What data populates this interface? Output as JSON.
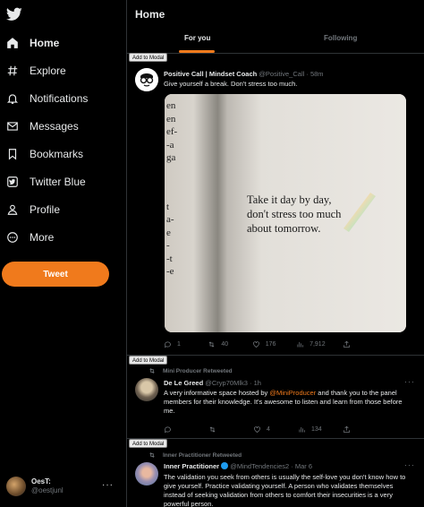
{
  "sidebar": {
    "nav": [
      {
        "label": "Home",
        "icon": "home-icon",
        "active": true
      },
      {
        "label": "Explore",
        "icon": "hashtag-icon"
      },
      {
        "label": "Notifications",
        "icon": "bell-icon"
      },
      {
        "label": "Messages",
        "icon": "envelope-icon"
      },
      {
        "label": "Bookmarks",
        "icon": "bookmark-icon"
      },
      {
        "label": "Twitter Blue",
        "icon": "twitter-blue-icon"
      },
      {
        "label": "Profile",
        "icon": "person-icon"
      },
      {
        "label": "More",
        "icon": "more-circle-icon"
      }
    ],
    "tweet_button": "Tweet",
    "account": {
      "name": "OesT:",
      "handle": "@oestjunl"
    }
  },
  "header": {
    "title": "Home",
    "tabs": [
      "For you",
      "Following"
    ]
  },
  "modal_tag": "Add to Modal",
  "tweets": [
    {
      "retweeted_by": "",
      "name": "Positive Call | Mindset Coach",
      "handle": "@Positive_Call",
      "time": "58m",
      "text": "Give yourself a break. Don't stress too much.",
      "image_text": [
        "Take it day by day,",
        "don't stress too much",
        "about tomorrow."
      ],
      "image_margin_text": [
        "en",
        "en",
        "ef-",
        "-a",
        "ga",
        "t",
        "a-",
        "e",
        "-",
        "-t",
        "-e"
      ],
      "stats": {
        "replies": "1",
        "retweets": "40",
        "likes": "176",
        "views": "7,912"
      }
    },
    {
      "retweeted_by": "Mini Producer Retweeted",
      "name": "De Le Greed",
      "handle": "@Cryp70Mlk3",
      "time": "1h",
      "text_parts": [
        "A very informative space hosted by ",
        "@MiniProducer",
        " and thank you to the panel members for their knowledge.  It's awesome to listen and learn from those before me."
      ],
      "stats": {
        "replies": "",
        "retweets": "",
        "likes": "4",
        "views": "134"
      }
    },
    {
      "retweeted_by": "Inner Practitioner Retweeted",
      "name": "Inner Practitioner",
      "handle": "@MindTendencies2",
      "time": "Mar 6",
      "text": "The validation you seek from others is usually the self-love you don't know how to give yourself. Practice validating yourself. A person who validates themselves instead of seeking validation from others to comfort their insecurities is a very powerful person."
    }
  ],
  "colors": {
    "accent": "#f07a1c",
    "background": "#000000",
    "muted": "#71767b",
    "text": "#e7e9ea"
  }
}
